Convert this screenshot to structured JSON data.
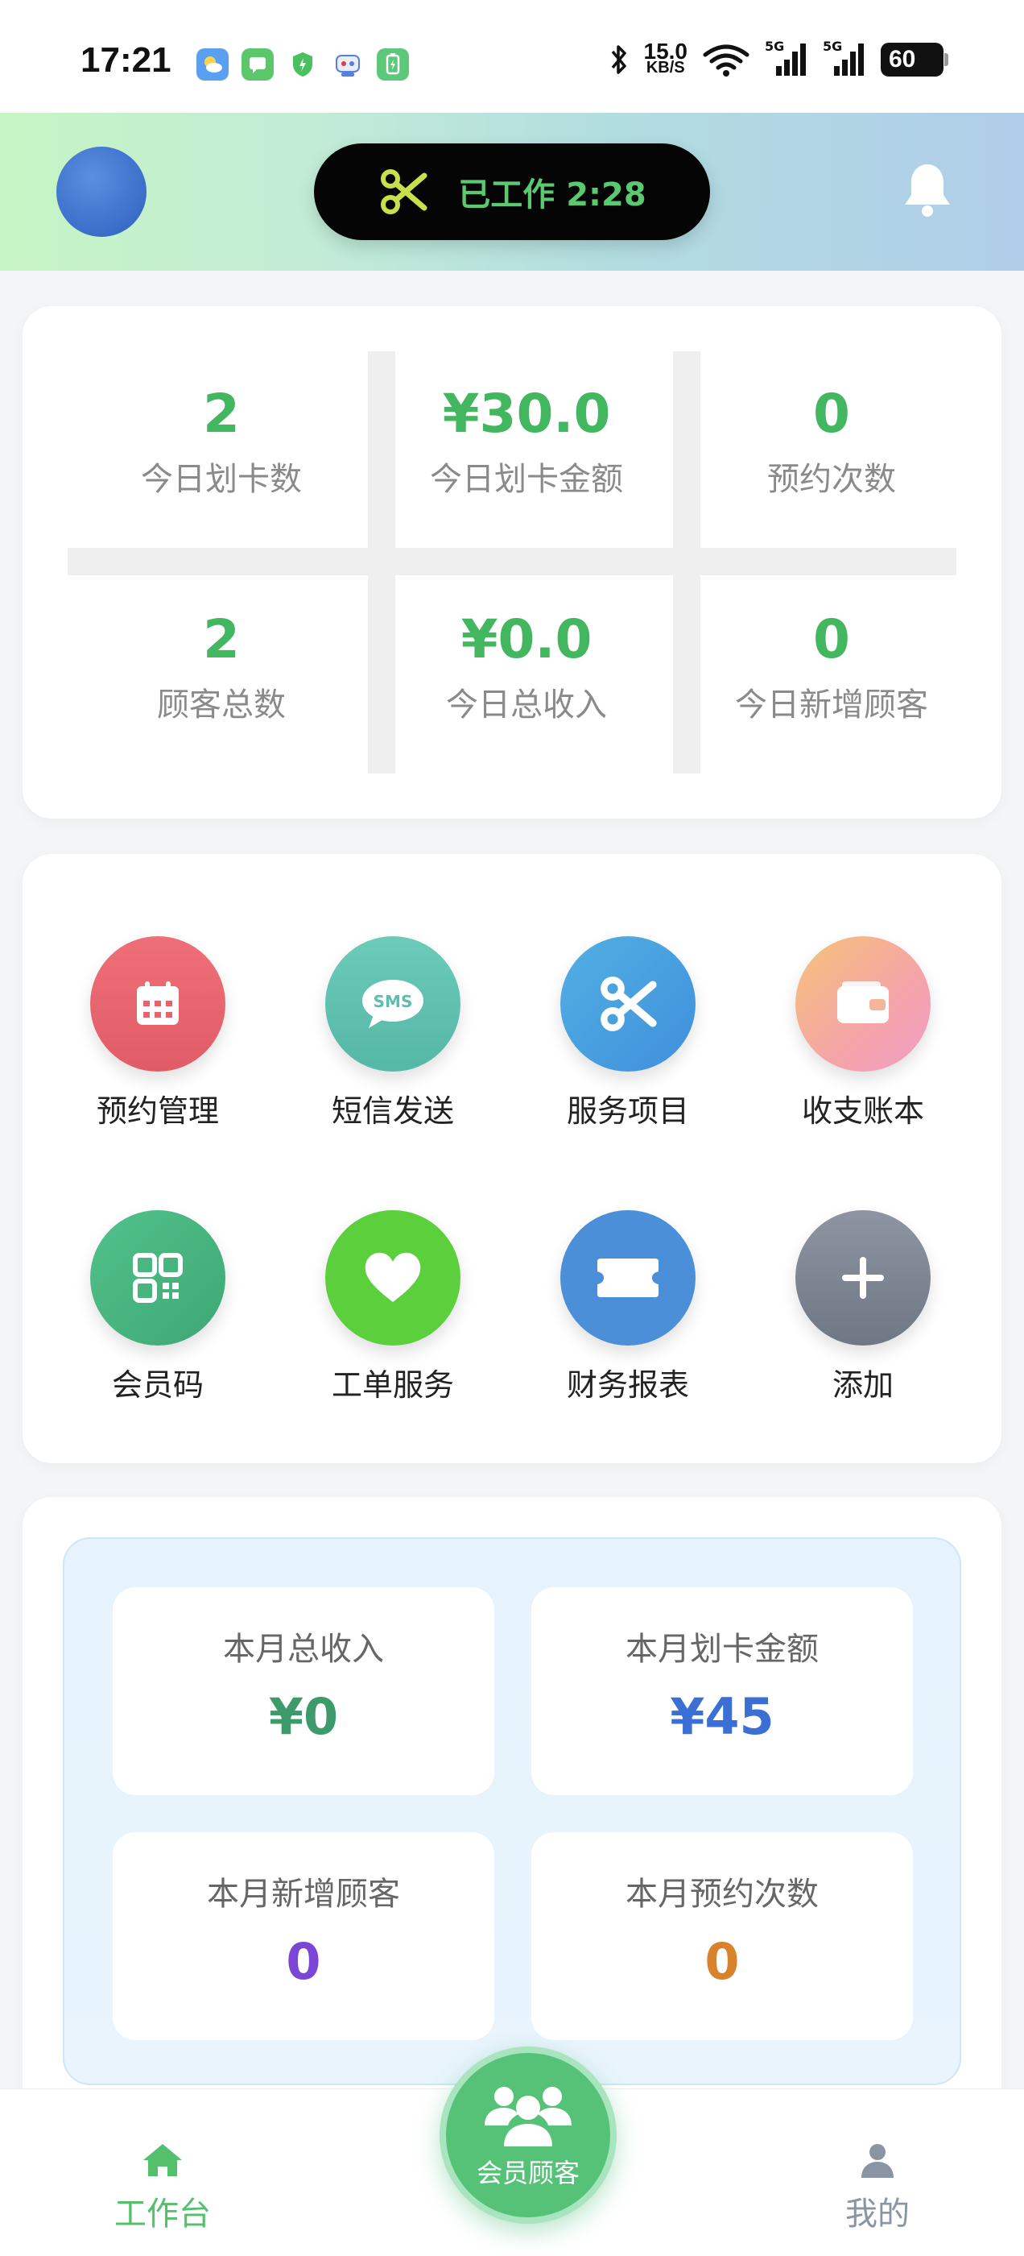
{
  "status_bar": {
    "time": "17:21",
    "net_speed_value": "15.0",
    "net_speed_unit": "KB/S",
    "signal1_label": "5G",
    "signal2_label": "5G",
    "battery": "60"
  },
  "header": {
    "work_status": "已工作 2:28",
    "colors": {
      "pill_bg": "#050505",
      "pill_text": "#5ac96f",
      "scissors": "#c8e04a"
    }
  },
  "today_stats": [
    {
      "value": "2",
      "label": "今日划卡数"
    },
    {
      "value": "¥30.0",
      "label": "今日划卡金额"
    },
    {
      "value": "0",
      "label": "预约次数"
    },
    {
      "value": "2",
      "label": "顾客总数"
    },
    {
      "value": "¥0.0",
      "label": "今日总收入"
    },
    {
      "value": "0",
      "label": "今日新增顾客"
    }
  ],
  "menu": [
    {
      "label": "预约管理",
      "icon": "calendar-icon",
      "color": "#e5636d"
    },
    {
      "label": "短信发送",
      "icon": "sms-icon",
      "color": "#5cbfae",
      "icon_text": "SMS"
    },
    {
      "label": "服务项目",
      "icon": "scissors-icon",
      "color": "#4b9fe0"
    },
    {
      "label": "收支账本",
      "icon": "wallet-icon",
      "color": "#f4a4a8"
    },
    {
      "label": "会员码",
      "icon": "qr-code-icon",
      "color": "#4fba80"
    },
    {
      "label": "工单服务",
      "icon": "heart-icon",
      "color": "#5ccf3c"
    },
    {
      "label": "财务报表",
      "icon": "ticket-icon",
      "color": "#4a8fd8"
    },
    {
      "label": "添加",
      "icon": "plus-icon",
      "color": "#7a8290"
    }
  ],
  "month_stats": [
    {
      "label": "本月总收入",
      "value": "¥0",
      "color": "#3d9a6a"
    },
    {
      "label": "本月划卡金额",
      "value": "¥45",
      "color": "#3b6fd4"
    },
    {
      "label": "本月新增顾客",
      "value": "0",
      "color": "#7b45d6"
    },
    {
      "label": "本月预约次数",
      "value": "0",
      "color": "#d8832c"
    }
  ],
  "bottom_nav": {
    "workbench": "工作台",
    "members": "会员顾客",
    "mine": "我的",
    "active_color": "#55c06c",
    "inactive_color": "#8a95a3"
  }
}
